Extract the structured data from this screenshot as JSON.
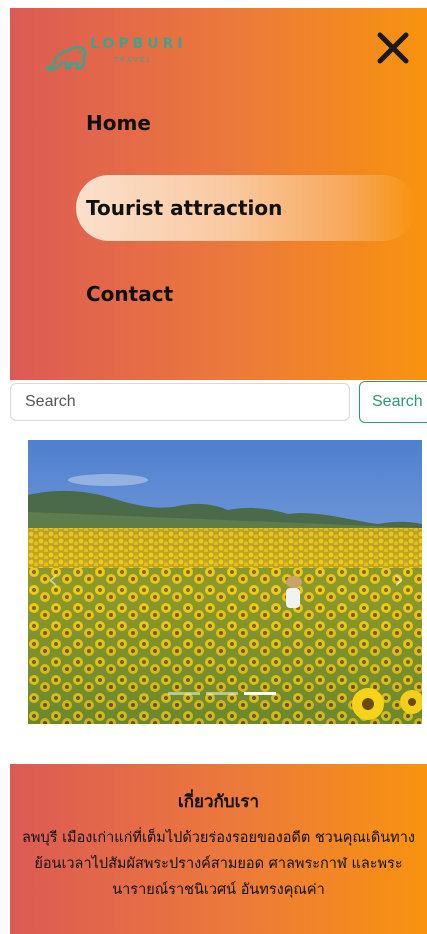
{
  "brand": {
    "logo_text": "LOPBURI",
    "logo_sub": "TRAVEL",
    "logo_color": "#3aa58a",
    "icon": "monkey-logo-icon"
  },
  "menu": {
    "gradient_start": "#dc5a55",
    "gradient_end": "#f8930f",
    "close_icon": "close-icon",
    "items": [
      {
        "label": "Home",
        "active": false
      },
      {
        "label": "Tourist attraction",
        "active": true
      },
      {
        "label": "Contact",
        "active": false
      }
    ]
  },
  "search": {
    "placeholder": "Search",
    "value": "",
    "button_label": "Search",
    "accent": "#2e9a6f"
  },
  "carousel": {
    "slides": 3,
    "active_index": 2,
    "prev_icon": "chevron-left-icon",
    "next_icon": "chevron-right-icon"
  },
  "about": {
    "title": "เกี่ยวกับเรา",
    "body": "ลพบุรี เมืองเก่าแก่ที่เต็มไปด้วยร่องรอยของอดีต ชวนคุณเดินทางย้อนเวลาไปสัมผัสพระปรางค์สามยอด ศาลพระกาฬ และพระนารายณ์ราชนิเวศน์ อันทรงคุณค่า"
  }
}
